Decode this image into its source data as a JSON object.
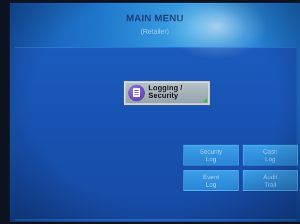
{
  "header": {
    "title": "MAIN MENU",
    "subtitle": "(Retailer)"
  },
  "main_button": {
    "label": "Logging /\nSecurity",
    "icon": "document-icon"
  },
  "sub_buttons": [
    {
      "label": "Security\nLog"
    },
    {
      "label": "Cash\nLog"
    },
    {
      "label": "Event\nLog"
    },
    {
      "label": "Audit\nTrail"
    }
  ],
  "colors": {
    "screen_blue": "#1f78cc",
    "panel_blue": "#1851b0",
    "button_grey": "#a8b3bc",
    "sub_button_blue": "#2a86d6"
  }
}
